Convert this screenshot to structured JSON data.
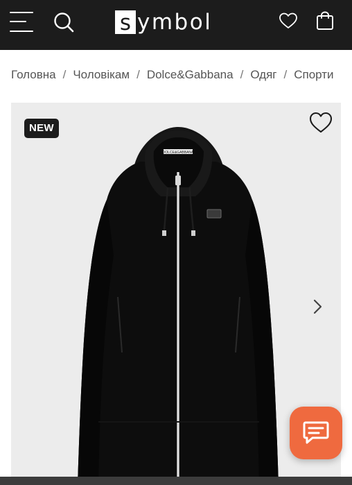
{
  "header": {
    "logo_letter": "s",
    "logo_rest": "ymbol",
    "menu_icon": "hamburger-menu-icon",
    "search_icon": "search-icon",
    "wishlist_icon": "heart-icon",
    "bag_icon": "shopping-bag-icon",
    "background_color": "#1c1c1c"
  },
  "breadcrumbs": {
    "items": [
      "Головна",
      "Чоловікам",
      "Dolce&Gabbana",
      "Одяг",
      "Спорти"
    ],
    "separator": "/"
  },
  "product_gallery": {
    "badge": "NEW",
    "favorite_icon": "heart-outline-icon",
    "next_icon": "chevron-right-icon",
    "image": "black zip-up hooded sweatshirt",
    "label_text": "DOLCE&GABBANA",
    "background_color": "#ececec"
  },
  "chat_widget": {
    "icon": "chat-bubble-icon",
    "color": "#ef6a3f"
  }
}
